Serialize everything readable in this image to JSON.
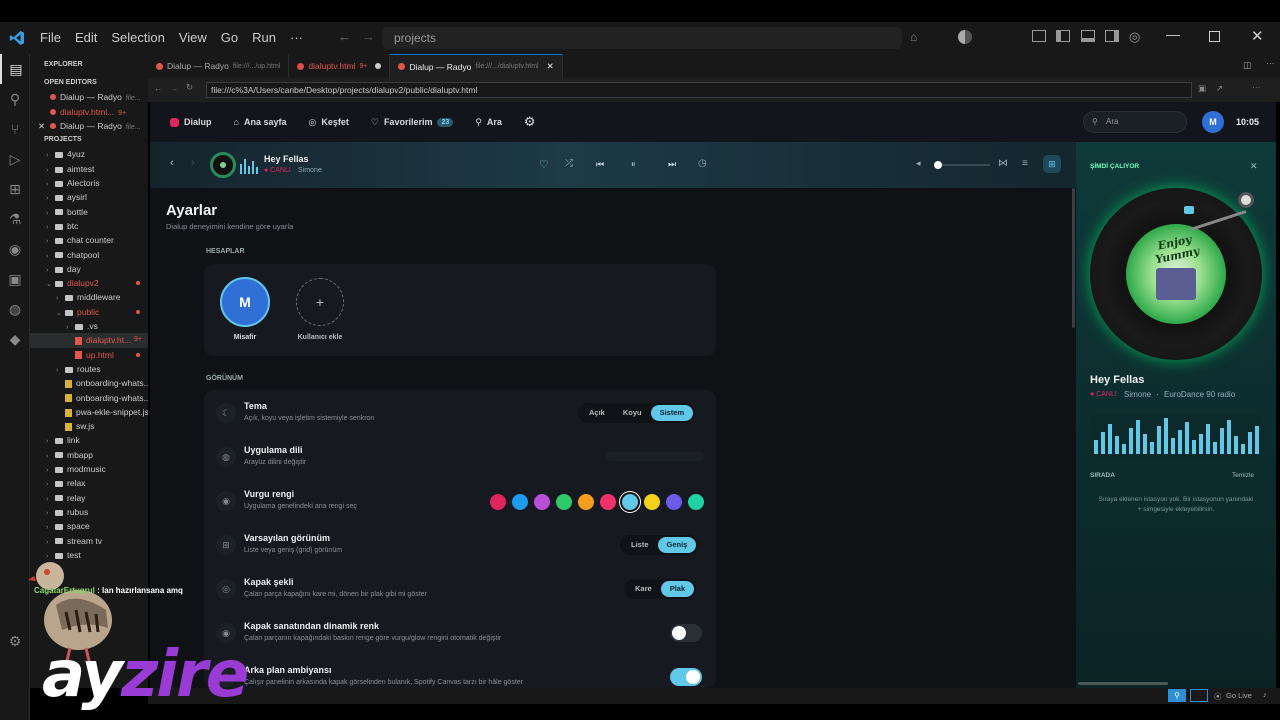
{
  "vscode": {
    "menu": [
      "File",
      "Edit",
      "Selection",
      "View",
      "Go",
      "Run",
      "···"
    ],
    "command_center": "projects",
    "explorer_title": "EXPLORER",
    "open_editors_title": "OPEN EDITORS",
    "open_editors": [
      {
        "label": "Dialup — Radyo",
        "meta": "file...",
        "color": "#cccccc",
        "close": false
      },
      {
        "label": "dialuptv.html...",
        "meta": "9+",
        "color": "#e2574c",
        "close": false
      },
      {
        "label": "Dialup — Radyo",
        "meta": "file...",
        "color": "#cccccc",
        "close": true
      }
    ],
    "projects_title": "PROJECTS",
    "tree": [
      {
        "label": "4yuz",
        "indent": 1,
        "type": "folder"
      },
      {
        "label": "aimtest",
        "indent": 1,
        "type": "folder"
      },
      {
        "label": "Alectoris",
        "indent": 1,
        "type": "folder"
      },
      {
        "label": "aysirl",
        "indent": 1,
        "type": "folder"
      },
      {
        "label": "bottle",
        "indent": 1,
        "type": "folder"
      },
      {
        "label": "btc",
        "indent": 1,
        "type": "folder"
      },
      {
        "label": "chat counter",
        "indent": 1,
        "type": "folder"
      },
      {
        "label": "chatpool",
        "indent": 1,
        "type": "folder"
      },
      {
        "label": "day",
        "indent": 1,
        "type": "folder"
      },
      {
        "label": "dialupv2",
        "indent": 1,
        "type": "folder-open",
        "color": "#e2574c"
      },
      {
        "label": "middleware",
        "indent": 2,
        "type": "folder"
      },
      {
        "label": "public",
        "indent": 2,
        "type": "folder-open",
        "color": "#e2574c"
      },
      {
        "label": ".vs",
        "indent": 3,
        "type": "folder"
      },
      {
        "label": "dialuptv.ht...",
        "indent": 3,
        "type": "file",
        "color": "#e2574c",
        "meta": "9+"
      },
      {
        "label": "up.html",
        "indent": 3,
        "type": "file",
        "color": "#e2574c"
      },
      {
        "label": "routes",
        "indent": 2,
        "type": "folder"
      },
      {
        "label": "onboarding-whats...",
        "indent": 2,
        "type": "file"
      },
      {
        "label": "onboarding-whats...",
        "indent": 2,
        "type": "file"
      },
      {
        "label": "pwa-ekle-snippet.js",
        "indent": 2,
        "type": "file"
      },
      {
        "label": "sw.js",
        "indent": 2,
        "type": "file"
      },
      {
        "label": "link",
        "indent": 1,
        "type": "folder"
      },
      {
        "label": "mbapp",
        "indent": 1,
        "type": "folder"
      },
      {
        "label": "modmusic",
        "indent": 1,
        "type": "folder"
      },
      {
        "label": "relax",
        "indent": 1,
        "type": "folder"
      },
      {
        "label": "relay",
        "indent": 1,
        "type": "folder"
      },
      {
        "label": "rubus",
        "indent": 1,
        "type": "folder"
      },
      {
        "label": "space",
        "indent": 1,
        "type": "folder"
      },
      {
        "label": "stream tv",
        "indent": 1,
        "type": "folder"
      },
      {
        "label": "test",
        "indent": 1,
        "type": "folder"
      }
    ],
    "tabs": [
      {
        "label": "Dialup — Radyo",
        "path": "file:///.../up.html",
        "active": false,
        "dirty": false
      },
      {
        "label": "dialuptv.html",
        "path": "9+",
        "active": false,
        "dirty": true
      },
      {
        "label": "Dialup — Radyo",
        "path": "file:///.../dialuptv.html",
        "active": true,
        "dirty": false
      }
    ],
    "url": "file:///c%3A/Users/canbe/Desktop/projects/dialupv2/public/dialuptv.html",
    "status_right": [
      "Go Live"
    ]
  },
  "app": {
    "brand": "Dialup",
    "nav": [
      {
        "label": "Ana sayfa",
        "icon": "home-icon"
      },
      {
        "label": "Keşfet",
        "icon": "compass-icon"
      },
      {
        "label": "Favorilerim",
        "icon": "heart-icon",
        "badge": "23"
      },
      {
        "label": "Ara",
        "icon": "search-icon"
      }
    ],
    "search_placeholder": "Ara",
    "avatar_letter": "M",
    "clock": "10:05",
    "player": {
      "title": "Hey Fellas",
      "live": "● CANLI",
      "artist": "Simone"
    },
    "settings": {
      "title": "Ayarlar",
      "subtitle": "Dialup deneyimini kendine göre uyarla",
      "accounts_title": "HESAPLAR",
      "accounts": [
        {
          "letter": "M",
          "name": "Misafir"
        },
        {
          "letter": "+",
          "name": "Kullanıcı ekle"
        }
      ],
      "appearance_title": "GÖRÜNÜM",
      "rows": [
        {
          "title": "Tema",
          "desc": "Açık, koyu veya işletim sistemiyle senkron"
        },
        {
          "title": "Uygulama dili",
          "desc": "Arayüz dilini değiştir"
        },
        {
          "title": "Vurgu rengi",
          "desc": "Uygulama genelindeki ana rengi seç"
        },
        {
          "title": "Varsayılan görünüm",
          "desc": "Liste veya geniş (grid) görünüm"
        },
        {
          "title": "Kapak şekli",
          "desc": "Çalan parça kapağını kare mi, dönen bir plak gibi mi göster"
        },
        {
          "title": "Kapak sanatından dinamik renk",
          "desc": "Çalan parçanın kapağındaki baskın renge göre vurgu/glow rengini otomatik değiştir"
        },
        {
          "title": "Arka plan ambiyansı",
          "desc": "Çalışır panelinin arkasında kapak görselinden bulanık, Spotify Canvas tarzı bir hâle göster"
        }
      ],
      "theme_options": [
        "Açık",
        "Koyu",
        "Sistem"
      ],
      "theme_selected": "Sistem",
      "view_options": [
        "Liste",
        "Geniş"
      ],
      "view_selected": "Geniş",
      "cover_options": [
        "Kare",
        "Plak"
      ],
      "cover_selected": "Plak",
      "dynamic_color_on": false,
      "ambient_on": true,
      "accent_colors": [
        "#e0245e",
        "#1d9bf0",
        "#b84fd6",
        "#2fc96b",
        "#f59e1b",
        "#f0326a",
        "#62c8e8",
        "#f4d21c",
        "#6b5ce7",
        "#1fd1a5"
      ],
      "accent_selected": "#62c8e8"
    },
    "now_playing": {
      "header": "ŞİMDİ ÇALIYOR",
      "title": "Hey Fellas",
      "live": "● CANLI",
      "artist": "Simone",
      "station": "EuroDance 90 radio",
      "queue_title": "SIRADA",
      "queue_clear": "Temizle",
      "queue_empty": "Sıraya eklenen istasyon yok. Bir istasyonun yanındaki + simgesiyle ekleyebilirsin.",
      "cover_text": "Enjoy Yummy"
    }
  },
  "overlay": {
    "chat_user": "CagatarErtugrul",
    "chat_message": "lan hazırlansana amq",
    "brand_a": "ay",
    "brand_b": "zire"
  }
}
